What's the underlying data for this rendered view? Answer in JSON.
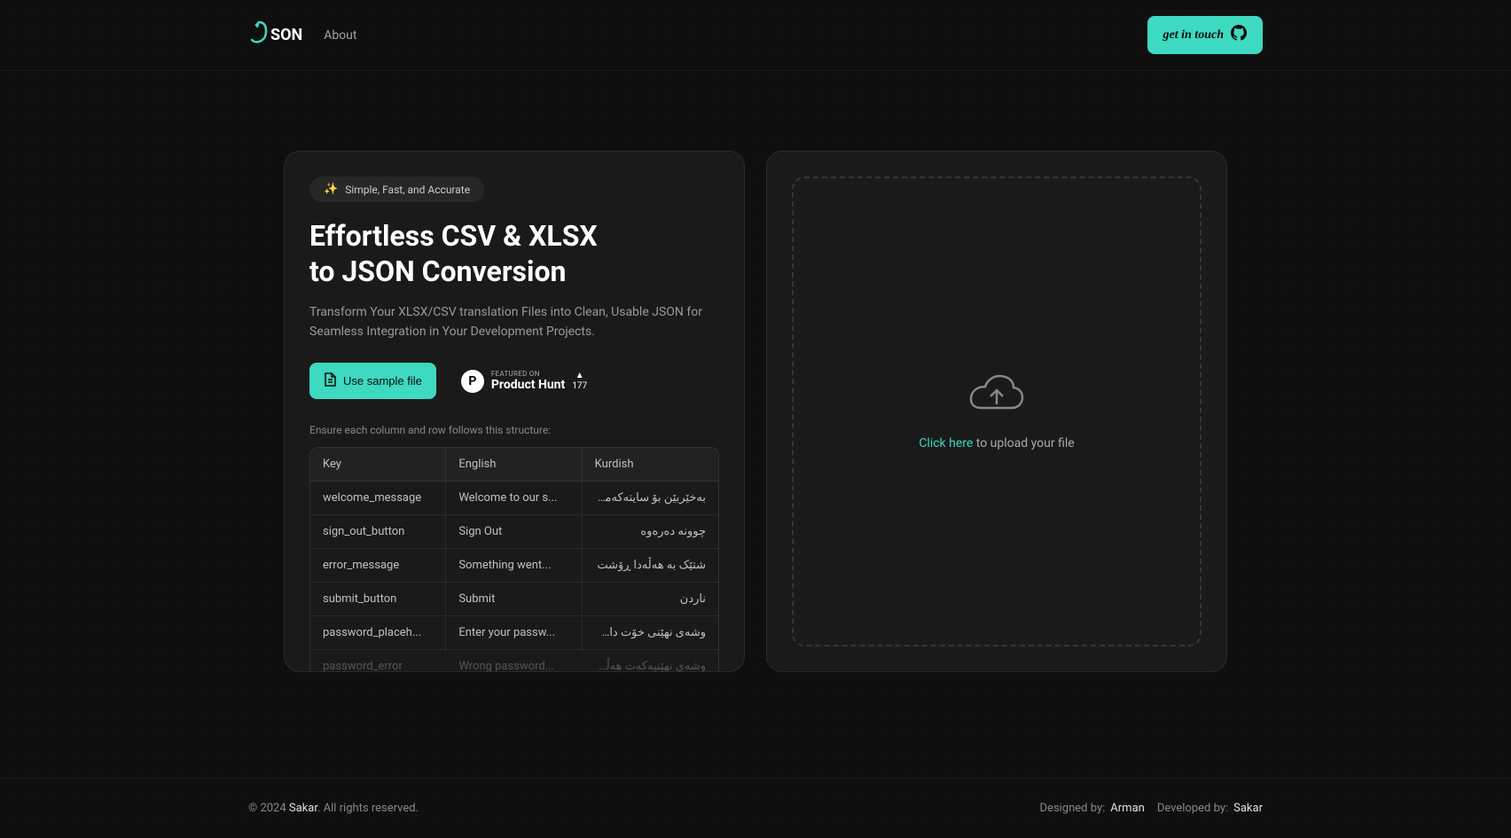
{
  "header": {
    "logo_text": "SON",
    "nav": {
      "about": "About"
    },
    "cta": "get in touch"
  },
  "hero": {
    "badge": "Simple, Fast, and Accurate",
    "title_line1": "Effortless CSV & XLSX",
    "title_line2": "to JSON Conversion",
    "subtitle": "Transform Your XLSX/CSV translation Files into Clean, Usable JSON for Seamless Integration in Your Development Projects.",
    "sample_btn": "Use sample file",
    "product_hunt": {
      "featured": "FEATURED ON",
      "name": "Product Hunt",
      "votes": "177"
    },
    "instruction": "Ensure each column and row follows this structure:",
    "table": {
      "headers": [
        "Key",
        "English",
        "Kurdish"
      ],
      "rows": [
        {
          "key": "welcome_message",
          "en": "Welcome to our s...",
          "ku": "بەخێربێن بۆ سایتەکەمان"
        },
        {
          "key": "sign_out_button",
          "en": "Sign Out",
          "ku": "چوونە دەرەوە"
        },
        {
          "key": "error_message",
          "en": "Something went...",
          "ku": "شتێک بە هەڵەدا ڕۆشت"
        },
        {
          "key": "submit_button",
          "en": "Submit",
          "ku": "ناردن"
        },
        {
          "key": "password_placeh...",
          "en": "Enter your passw...",
          "ku": "وشەی نهێنی خۆت داخل ب..."
        },
        {
          "key": "password_error",
          "en": "Wrong password...",
          "ku": "وشەی نهێنیەکەت هەڵەی..."
        }
      ]
    }
  },
  "upload": {
    "click_here": "Click here",
    "rest": " to upload your file"
  },
  "footer": {
    "copyright_prefix": "© 2024 ",
    "copyright_name": "Sakar",
    "copyright_suffix": ". All rights reserved.",
    "designed_label": "Designed by: ",
    "designed_name": "Arman",
    "developed_label": "Developed by: ",
    "developed_name": "Sakar"
  }
}
